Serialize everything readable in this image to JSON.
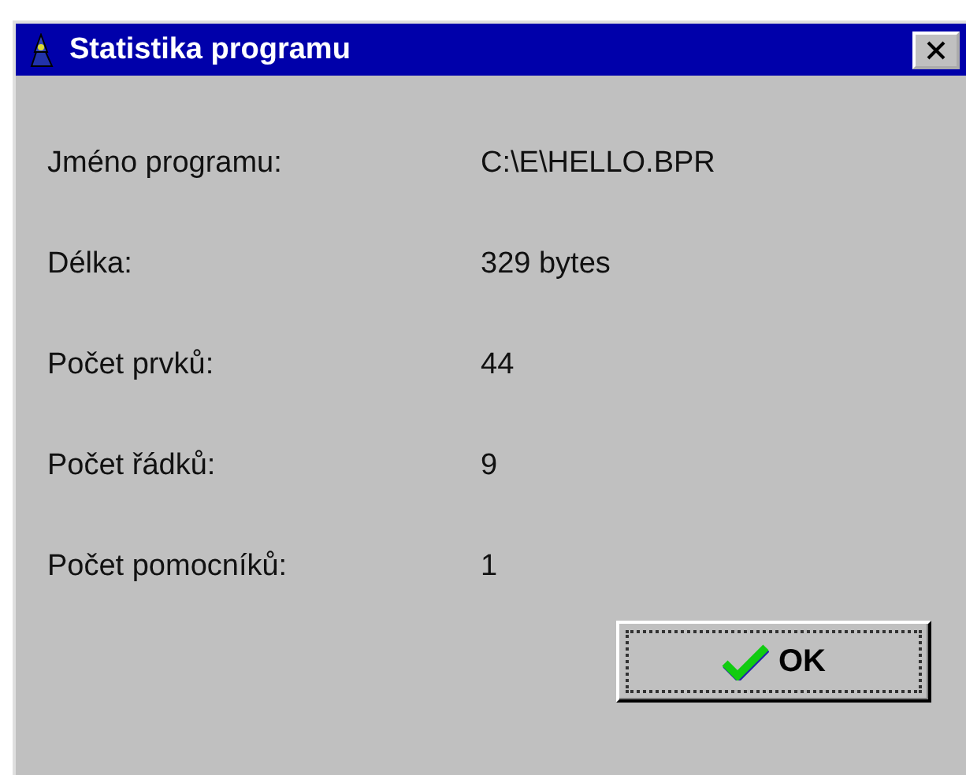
{
  "window": {
    "title": "Statistika programu"
  },
  "fields": [
    {
      "label": "Jméno programu:",
      "value": "C:\\E\\HELLO.BPR"
    },
    {
      "label": "Délka:",
      "value": "329 bytes"
    },
    {
      "label": "Počet prvků:",
      "value": "44"
    },
    {
      "label": "Počet řádků:",
      "value": "9"
    },
    {
      "label": "Počet pomocníků:",
      "value": "1"
    }
  ],
  "buttons": [
    {
      "label": "OK",
      "kind": "ok"
    }
  ]
}
